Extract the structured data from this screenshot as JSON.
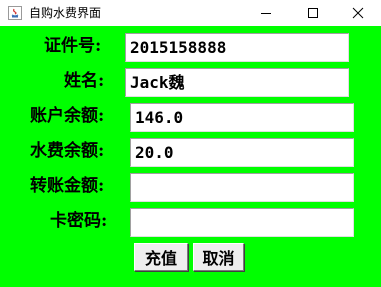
{
  "window": {
    "title": "自购水费界面"
  },
  "form": {
    "fields": [
      {
        "label": "证件号:",
        "value": "2015158888"
      },
      {
        "label": "姓名:",
        "value": "Jack魏"
      },
      {
        "label": "账户余额:",
        "value": "146.0"
      },
      {
        "label": "水费余额:",
        "value": "20.0"
      },
      {
        "label": "转账金额:",
        "value": ""
      },
      {
        "label": "卡密码:",
        "value": ""
      }
    ]
  },
  "buttons": {
    "recharge_label": "充值",
    "cancel_label": "取消"
  },
  "colors": {
    "background": "#00ff00",
    "field_bg": "#ffffff"
  }
}
